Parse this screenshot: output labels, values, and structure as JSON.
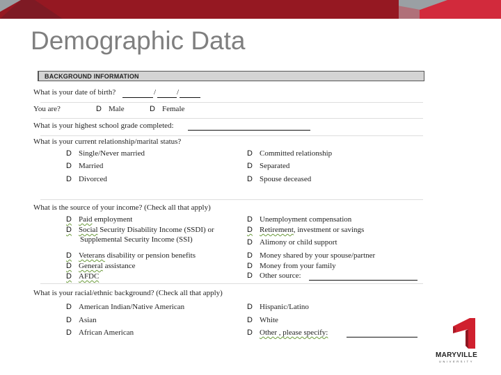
{
  "page": {
    "title": "Demographic Data"
  },
  "brand": {
    "name": "MARYVILLE",
    "sub": "UNIVERSITY",
    "colors": {
      "banner": "#951822",
      "accent": "#d22a3c",
      "title_gray": "#7f7f7f"
    }
  },
  "form": {
    "section_title": "BACKGROUND INFORMATION",
    "checkbox_glyph": "D",
    "dob": {
      "label": "What is your date of birth?",
      "sep1": "/",
      "sep2": "/"
    },
    "sex": {
      "label": "You are?",
      "options": [
        "Male",
        "Female"
      ]
    },
    "grade": {
      "label": "What is your highest school grade completed:"
    },
    "marital": {
      "label": "What is your current relationship/marital status?",
      "left": [
        "Single/Never married",
        "Married",
        "Divorced"
      ],
      "right": [
        "Committed relationship",
        "Separated",
        "Spouse deceased"
      ]
    },
    "income": {
      "label": "What is the source of your income?  (Check all that apply)",
      "left": [
        {
          "lead": "Paid",
          "rest": " employment"
        },
        {
          "lead": "Social",
          "rest": " Security Disability Income (SSDI) or"
        },
        {
          "lead": "",
          "rest": "Supplemental Security Income (SSI)"
        },
        {
          "lead": "Veterans",
          "rest": " disability or pension benefits"
        },
        {
          "lead": "General",
          "rest": " assistance"
        },
        {
          "lead": "AFDC",
          "rest": ""
        }
      ],
      "right": [
        {
          "lead": "",
          "rest": "Unemployment compensation"
        },
        {
          "lead": "Retirement",
          "rest": ", investment or savings"
        },
        {
          "lead": "",
          "rest": "Alimony or child support"
        },
        {
          "lead": "",
          "rest": "Money shared by  your spouse/partner"
        },
        {
          "lead": "",
          "rest": "Money from your family"
        },
        {
          "lead": "",
          "rest": "Other source:"
        }
      ]
    },
    "ethnic": {
      "label": "What is your racial/ethnic background?  (Check all that apply)",
      "left": [
        "American Indian/Native American",
        "Asian",
        "African American"
      ],
      "right": [
        "Hispanic/Latino",
        "White",
        "Other , please specify:"
      ]
    }
  }
}
